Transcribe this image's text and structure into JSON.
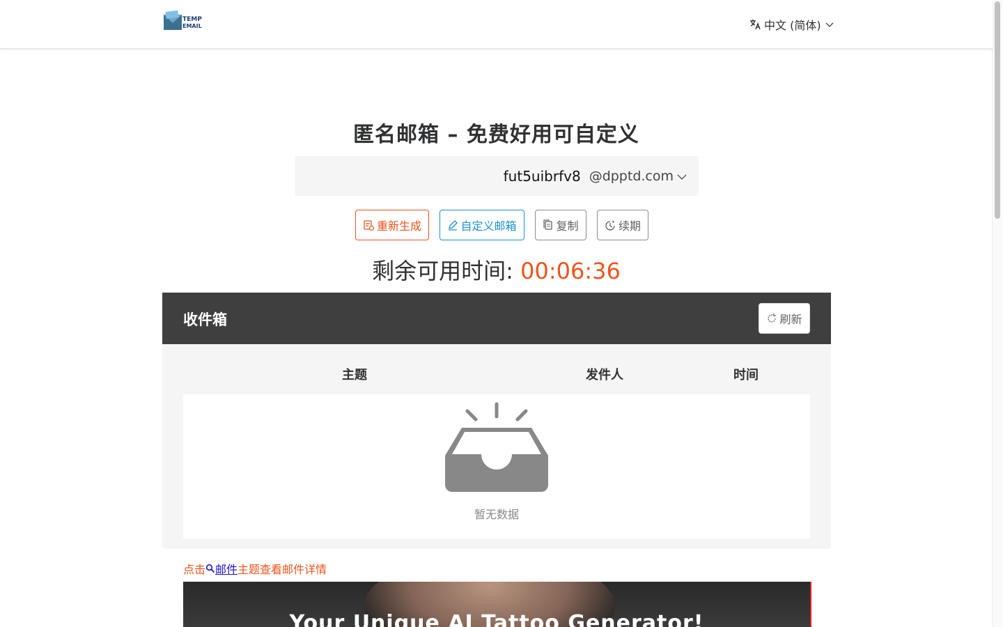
{
  "header": {
    "logo_alt": "TEMP EMAIL",
    "language_label": "中文 (简体)"
  },
  "hero": {
    "title": "匿名邮箱 – 免费好用可自定义",
    "email_user": "fut5uibrfv8",
    "email_domain": "@dpptd.com",
    "buttons": {
      "regenerate": "重新生成",
      "custom": "自定义邮箱",
      "copy": "复制",
      "renew": "续期"
    },
    "timer_label": "剩余可用时间:",
    "timer_value": "00:06:36"
  },
  "inbox": {
    "title": "收件箱",
    "refresh_label": "刷新",
    "columns": [
      "主题",
      "发件人",
      "时间"
    ],
    "empty_text": "暂无数据"
  },
  "hint": {
    "prefix": "点击",
    "link": "邮件",
    "suffix": "主题查看邮件详情"
  },
  "banner": {
    "text": "Your Unique AI Tattoo Generator!"
  },
  "colors": {
    "accent_orange": "#f0531c",
    "accent_blue": "#1a8fd6",
    "inbox_header": "#3f3f3f"
  }
}
